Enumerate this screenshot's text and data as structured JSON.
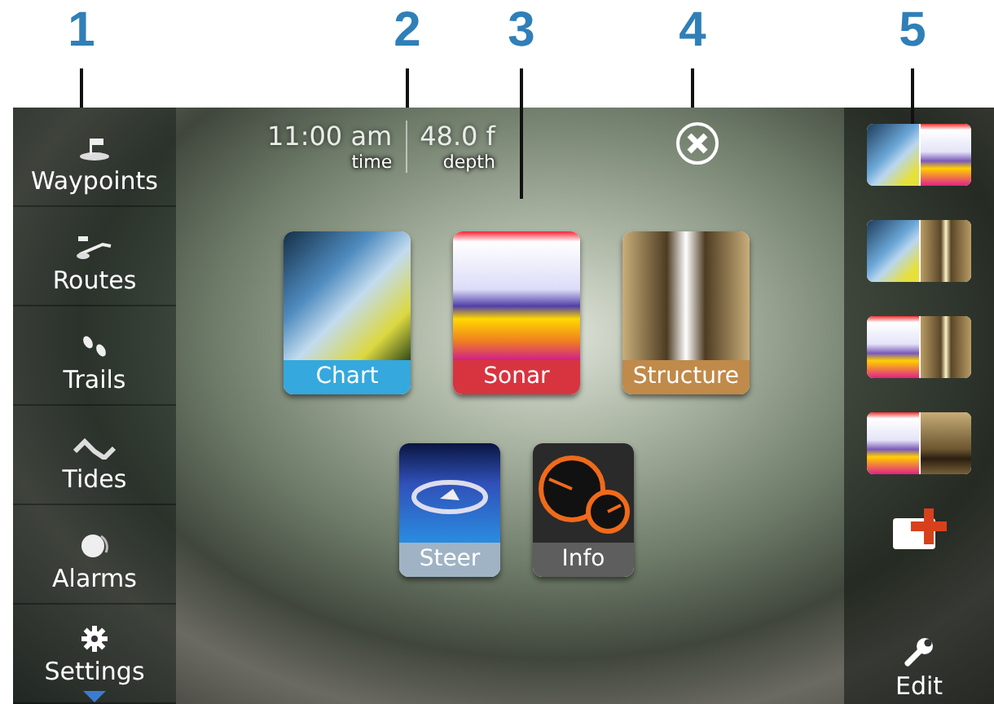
{
  "callouts": [
    {
      "label": "1"
    },
    {
      "label": "2"
    },
    {
      "label": "3"
    },
    {
      "label": "4"
    },
    {
      "label": "5"
    }
  ],
  "sidebar": {
    "items": [
      {
        "kind": "waypoint",
        "label": "Waypoints"
      },
      {
        "kind": "route",
        "label": "Routes"
      },
      {
        "kind": "trail",
        "label": "Trails"
      },
      {
        "kind": "tide",
        "label": "Tides"
      },
      {
        "kind": "alarm",
        "label": "Alarms"
      },
      {
        "kind": "settings",
        "label": "Settings"
      }
    ]
  },
  "status": [
    {
      "value": "11:00 am",
      "caption": "time"
    },
    {
      "value": "48.0 f",
      "caption": "depth"
    }
  ],
  "apps": [
    {
      "kind": "chart",
      "label": "Chart",
      "color": "#35a8de"
    },
    {
      "kind": "sonar",
      "label": "Sonar",
      "color": "#d8343f"
    },
    {
      "kind": "structure",
      "label": "Structure",
      "color": "#c08a4a"
    },
    {
      "kind": "steer",
      "label": "Steer",
      "color": "#9fb3c4"
    },
    {
      "kind": "info",
      "label": "Info",
      "color": "#5e5e5e"
    }
  ],
  "favorites": [
    {
      "panes": [
        {
          "kind": "chart"
        },
        {
          "kind": "sonar"
        }
      ]
    },
    {
      "panes": [
        {
          "kind": "chart"
        },
        {
          "kind": "structure"
        }
      ]
    },
    {
      "panes": [
        {
          "kind": "sonar"
        },
        {
          "kind": "structure"
        }
      ]
    },
    {
      "panes": [
        {
          "kind": "sonar"
        },
        {
          "kind": "downscan"
        }
      ]
    }
  ],
  "edit": {
    "label": "Edit"
  }
}
